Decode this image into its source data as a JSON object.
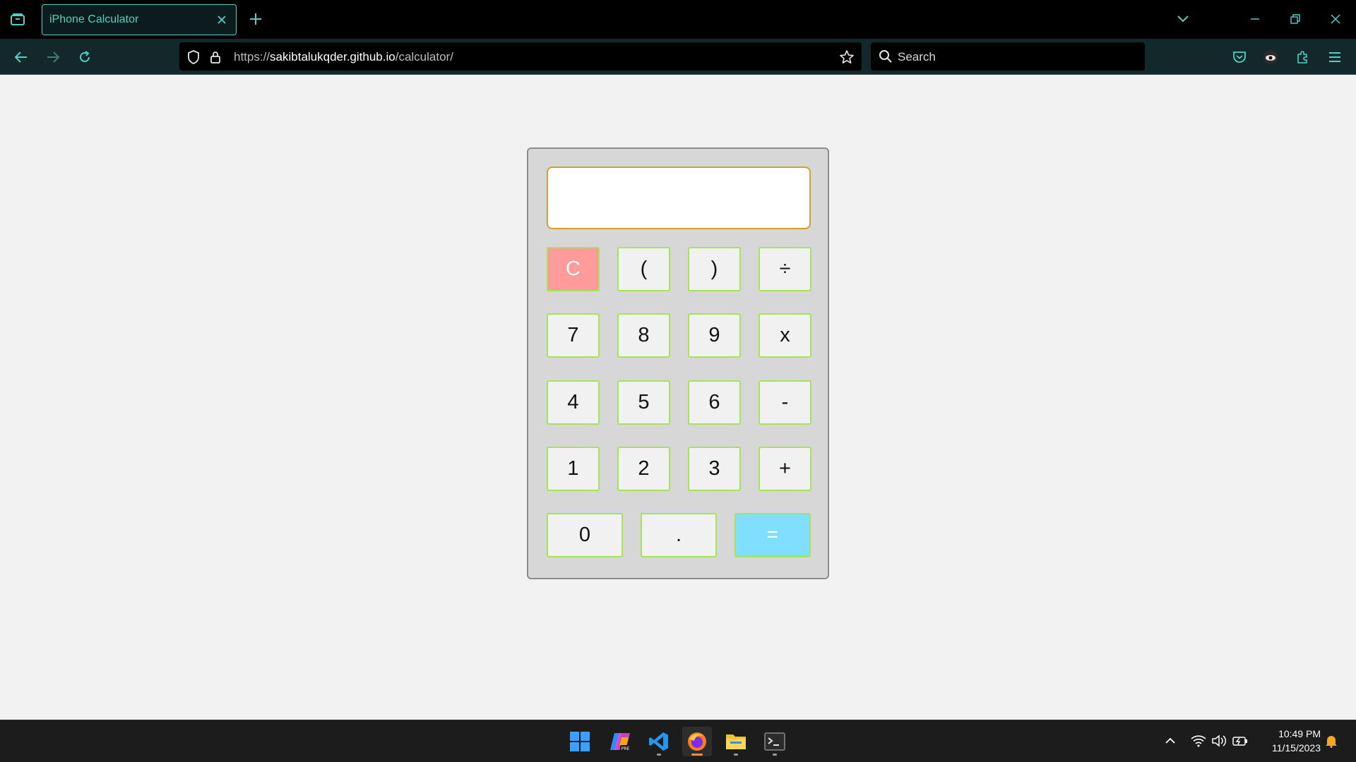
{
  "browser": {
    "tab_title": "iPhone Calculator",
    "url_prefix": "https://",
    "url_host": "sakibtalukqder.github.io",
    "url_path": "/calculator/",
    "search_placeholder": "Search"
  },
  "calculator": {
    "display_value": "",
    "rows": [
      [
        "C",
        "(",
        ")",
        "÷"
      ],
      [
        "7",
        "8",
        "9",
        "x"
      ],
      [
        "4",
        "5",
        "6",
        "-"
      ],
      [
        "1",
        "2",
        "3",
        "+"
      ],
      [
        "0",
        ".",
        "="
      ]
    ],
    "colors": {
      "clear": "#ff9b9b",
      "equals": "#80deff",
      "key_border": "#a6e35a",
      "display_border": "#d4a02d"
    }
  },
  "taskbar": {
    "apps": [
      "start-icon",
      "copilot-pre-icon",
      "vscode-icon",
      "firefox-icon",
      "file-explorer-icon",
      "terminal-icon"
    ],
    "time": "10:49 PM",
    "date": "11/15/2023"
  }
}
